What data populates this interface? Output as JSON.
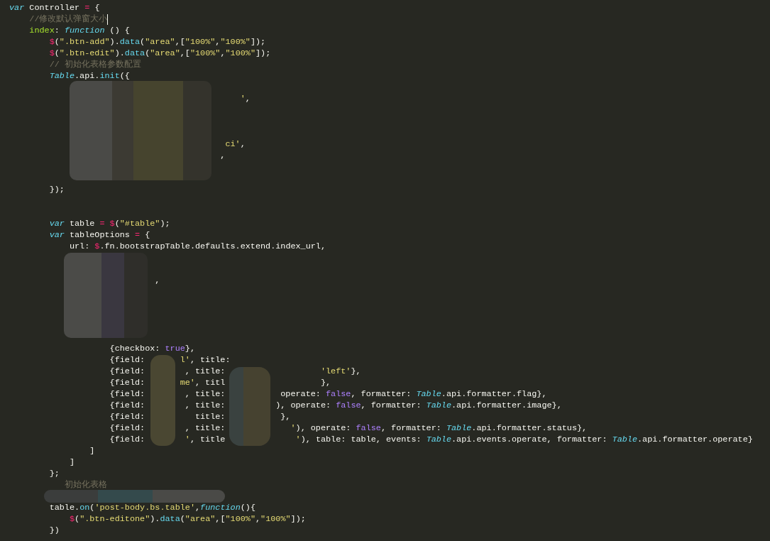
{
  "editor": {
    "lines": [
      {
        "cursor": false,
        "tokens": [
          {
            "kind": "keyword",
            "text": "var"
          },
          {
            "kind": "plain",
            "text": " Controller "
          },
          {
            "kind": "operator",
            "text": "="
          },
          {
            "kind": "plain",
            "text": " {"
          }
        ]
      },
      {
        "cursor": true,
        "tokens": [
          {
            "kind": "comment",
            "text": "    //修改默认弹窗大小"
          }
        ]
      },
      {
        "cursor": false,
        "tokens": [
          {
            "kind": "name",
            "text": "    index"
          },
          {
            "kind": "plain",
            "text": ": "
          },
          {
            "kind": "keyword",
            "text": "function"
          },
          {
            "kind": "plain",
            "text": " () {"
          }
        ]
      },
      {
        "cursor": false,
        "tokens": [
          {
            "kind": "operator",
            "text": "        $"
          },
          {
            "kind": "plain",
            "text": "("
          },
          {
            "kind": "string",
            "text": "\".btn-add\""
          },
          {
            "kind": "plain",
            "text": ")."
          },
          {
            "kind": "method",
            "text": "data"
          },
          {
            "kind": "plain",
            "text": "("
          },
          {
            "kind": "string",
            "text": "\"area\""
          },
          {
            "kind": "plain",
            "text": ",["
          },
          {
            "kind": "string",
            "text": "\"100%\""
          },
          {
            "kind": "plain",
            "text": ","
          },
          {
            "kind": "string",
            "text": "\"100%\""
          },
          {
            "kind": "plain",
            "text": "]);"
          }
        ]
      },
      {
        "cursor": false,
        "tokens": [
          {
            "kind": "operator",
            "text": "        $"
          },
          {
            "kind": "plain",
            "text": "("
          },
          {
            "kind": "string",
            "text": "\".btn-edit\""
          },
          {
            "kind": "plain",
            "text": ")."
          },
          {
            "kind": "method",
            "text": "data"
          },
          {
            "kind": "plain",
            "text": "("
          },
          {
            "kind": "string",
            "text": "\"area\""
          },
          {
            "kind": "plain",
            "text": ",["
          },
          {
            "kind": "string",
            "text": "\"100%\""
          },
          {
            "kind": "plain",
            "text": ","
          },
          {
            "kind": "string",
            "text": "\"100%\""
          },
          {
            "kind": "plain",
            "text": "]);"
          }
        ]
      },
      {
        "cursor": false,
        "tokens": [
          {
            "kind": "comment",
            "text": "        // 初始化表格参数配置"
          }
        ]
      },
      {
        "cursor": false,
        "tokens": [
          {
            "kind": "class",
            "text": "        Table"
          },
          {
            "kind": "plain",
            "text": ".api."
          },
          {
            "kind": "method",
            "text": "init"
          },
          {
            "kind": "plain",
            "text": "({"
          }
        ]
      },
      {
        "cursor": false
      },
      {
        "cursor": false,
        "tokens": [
          {
            "kind": "string",
            "text": "                                              '"
          },
          {
            "kind": "plain",
            "text": ","
          }
        ]
      },
      {
        "cursor": false
      },
      {
        "cursor": false
      },
      {
        "cursor": false
      },
      {
        "cursor": false,
        "tokens": [
          {
            "kind": "string",
            "text": "                                           ci'"
          },
          {
            "kind": "plain",
            "text": ","
          }
        ]
      },
      {
        "cursor": false,
        "tokens": [
          {
            "kind": "plain",
            "text": "                                          ,"
          }
        ]
      },
      {
        "cursor": false
      },
      {
        "cursor": false
      },
      {
        "cursor": false,
        "tokens": [
          {
            "kind": "plain",
            "text": "        });"
          }
        ]
      },
      {
        "cursor": false
      },
      {
        "cursor": false
      },
      {
        "cursor": false,
        "tokens": [
          {
            "kind": "keyword",
            "text": "        var"
          },
          {
            "kind": "plain",
            "text": " table "
          },
          {
            "kind": "operator",
            "text": "= $"
          },
          {
            "kind": "plain",
            "text": "("
          },
          {
            "kind": "string",
            "text": "\"#table\""
          },
          {
            "kind": "plain",
            "text": ");"
          }
        ]
      },
      {
        "cursor": false,
        "tokens": [
          {
            "kind": "keyword",
            "text": "        var"
          },
          {
            "kind": "plain",
            "text": " tableOptions "
          },
          {
            "kind": "operator",
            "text": "="
          },
          {
            "kind": "plain",
            "text": " {"
          }
        ]
      },
      {
        "cursor": false,
        "tokens": [
          {
            "kind": "plain",
            "text": "            url: "
          },
          {
            "kind": "operator",
            "text": "$"
          },
          {
            "kind": "plain",
            "text": ".fn.bootstrapTable.defaults.extend.index_url,"
          }
        ]
      },
      {
        "cursor": false
      },
      {
        "cursor": false
      },
      {
        "cursor": false,
        "tokens": [
          {
            "kind": "plain",
            "text": "                             ,"
          }
        ]
      },
      {
        "cursor": false
      },
      {
        "cursor": false
      },
      {
        "cursor": false
      },
      {
        "cursor": false
      },
      {
        "cursor": false
      },
      {
        "cursor": false,
        "tokens": [
          {
            "kind": "plain",
            "text": "                    {checkbox: "
          },
          {
            "kind": "constant",
            "text": "true"
          },
          {
            "kind": "plain",
            "text": "},"
          }
        ]
      },
      {
        "cursor": false,
        "tokens": [
          {
            "kind": "plain",
            "text": "                    {field:       "
          },
          {
            "kind": "string",
            "text": "l'"
          },
          {
            "kind": "plain",
            "text": ", title:"
          }
        ]
      },
      {
        "cursor": false,
        "tokens": [
          {
            "kind": "plain",
            "text": "                    {field:        , title:                   "
          },
          {
            "kind": "string",
            "text": "'left'"
          },
          {
            "kind": "plain",
            "text": "},"
          }
        ]
      },
      {
        "cursor": false,
        "tokens": [
          {
            "kind": "plain",
            "text": "                    {field:       "
          },
          {
            "kind": "string",
            "text": "me'"
          },
          {
            "kind": "plain",
            "text": ", titl                   },"
          }
        ]
      },
      {
        "cursor": false,
        "tokens": [
          {
            "kind": "plain",
            "text": "                    {field:        , title:           operate: "
          },
          {
            "kind": "constant",
            "text": "false"
          },
          {
            "kind": "plain",
            "text": ", formatter: "
          },
          {
            "kind": "class",
            "text": "Table"
          },
          {
            "kind": "plain",
            "text": ".api.formatter.flag},"
          }
        ]
      },
      {
        "cursor": false,
        "tokens": [
          {
            "kind": "plain",
            "text": "                    {field:        , title:          ), operate: "
          },
          {
            "kind": "constant",
            "text": "false"
          },
          {
            "kind": "plain",
            "text": ", formatter: "
          },
          {
            "kind": "class",
            "text": "Table"
          },
          {
            "kind": "plain",
            "text": ".api.formatter.image},"
          }
        ]
      },
      {
        "cursor": false,
        "tokens": [
          {
            "kind": "plain",
            "text": "                    {field:          title:           },"
          }
        ]
      },
      {
        "cursor": false,
        "tokens": [
          {
            "kind": "plain",
            "text": "                    {field:        , title:             "
          },
          {
            "kind": "string",
            "text": "'"
          },
          {
            "kind": "plain",
            "text": "), operate: "
          },
          {
            "kind": "constant",
            "text": "false"
          },
          {
            "kind": "plain",
            "text": ", formatter: "
          },
          {
            "kind": "class",
            "text": "Table"
          },
          {
            "kind": "plain",
            "text": ".api.formatter.status},"
          }
        ]
      },
      {
        "cursor": false,
        "tokens": [
          {
            "kind": "plain",
            "text": "                    {field:        "
          },
          {
            "kind": "string",
            "text": "'"
          },
          {
            "kind": "plain",
            "text": ", title              "
          },
          {
            "kind": "string",
            "text": "'"
          },
          {
            "kind": "plain",
            "text": "), table: table, events: "
          },
          {
            "kind": "class",
            "text": "Table"
          },
          {
            "kind": "plain",
            "text": ".api.events.operate, formatter: "
          },
          {
            "kind": "class",
            "text": "Table"
          },
          {
            "kind": "plain",
            "text": ".api.formatter.operate}"
          }
        ]
      },
      {
        "cursor": false,
        "tokens": [
          {
            "kind": "plain",
            "text": "                ]"
          }
        ]
      },
      {
        "cursor": false,
        "tokens": [
          {
            "kind": "plain",
            "text": "            ]"
          }
        ]
      },
      {
        "cursor": false,
        "tokens": [
          {
            "kind": "plain",
            "text": "        };"
          }
        ]
      },
      {
        "cursor": false,
        "tokens": [
          {
            "kind": "comment",
            "text": "           初始化表格"
          }
        ]
      },
      {
        "cursor": false
      },
      {
        "cursor": false,
        "tokens": [
          {
            "kind": "plain",
            "text": "        table."
          },
          {
            "kind": "method",
            "text": "on"
          },
          {
            "kind": "plain",
            "text": "("
          },
          {
            "kind": "string",
            "text": "'post-body.bs.table'"
          },
          {
            "kind": "plain",
            "text": ","
          },
          {
            "kind": "keyword",
            "text": "function"
          },
          {
            "kind": "plain",
            "text": "(){"
          }
        ]
      },
      {
        "cursor": false,
        "tokens": [
          {
            "kind": "operator",
            "text": "            $"
          },
          {
            "kind": "plain",
            "text": "("
          },
          {
            "kind": "string",
            "text": "\".btn-editone\""
          },
          {
            "kind": "plain",
            "text": ")."
          },
          {
            "kind": "method",
            "text": "data"
          },
          {
            "kind": "plain",
            "text": "("
          },
          {
            "kind": "string",
            "text": "\"area\""
          },
          {
            "kind": "plain",
            "text": ",["
          },
          {
            "kind": "string",
            "text": "\"100%\""
          },
          {
            "kind": "plain",
            "text": ","
          },
          {
            "kind": "string",
            "text": "\"100%\""
          },
          {
            "kind": "plain",
            "text": "]);"
          }
        ]
      },
      {
        "cursor": false,
        "tokens": [
          {
            "kind": "plain",
            "text": "        })"
          }
        ]
      }
    ]
  }
}
